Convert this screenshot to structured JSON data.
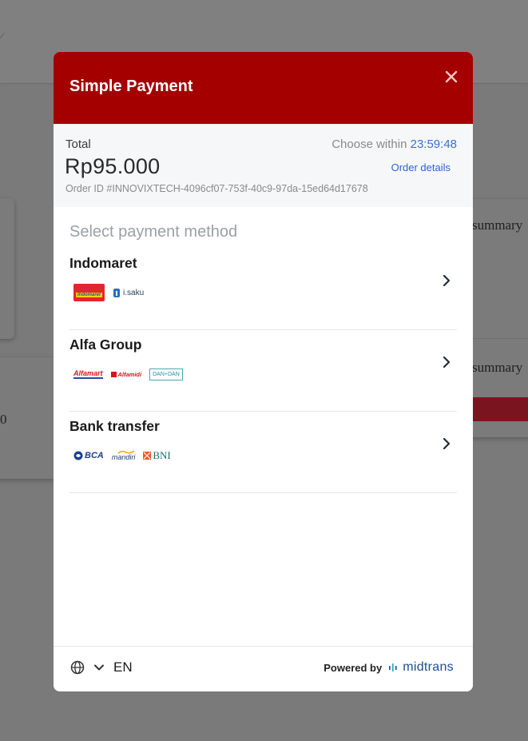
{
  "background": {
    "summary_text_1": "summary",
    "summary_text_2": "summary",
    "fragment_value": "0"
  },
  "modal": {
    "title": "Simple Payment",
    "close_icon": "close-icon",
    "total_label": "Total",
    "total_amount": "Rp95.000",
    "order_id": "Order ID #INNOVIXTECH-4096cf07-753f-40c9-97da-15ed64d17678",
    "choose_within_label": "Choose within",
    "countdown": "23:59:48",
    "order_details_link": "Order details",
    "select_method_label": "Select payment method",
    "methods": [
      {
        "label": "Indomaret",
        "logos": [
          "Indomaret",
          "i.saku"
        ]
      },
      {
        "label": "Alfa Group",
        "logos": [
          "Alfamart",
          "Alfamidi",
          "DAN+DAN"
        ]
      },
      {
        "label": "Bank transfer",
        "logos": [
          "BCA",
          "mandiri",
          "BNI"
        ]
      }
    ],
    "footer": {
      "language_code": "EN",
      "powered_by": "Powered by",
      "brand": "midtrans"
    }
  },
  "colors": {
    "header_red": "#a50000",
    "accent_blue": "#3b6fd8",
    "overlay_gray": "#7a7a7a"
  }
}
